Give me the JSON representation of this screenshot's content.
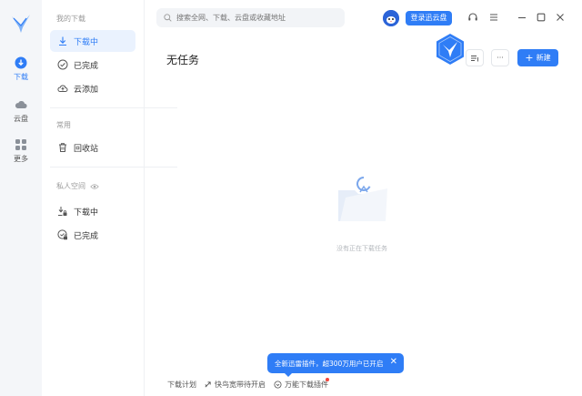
{
  "rail": {
    "items": [
      {
        "label": "下载",
        "icon": "download-circle-icon"
      },
      {
        "label": "云盘",
        "icon": "cloud-icon"
      },
      {
        "label": "更多",
        "icon": "grid-icon"
      }
    ]
  },
  "sidebar": {
    "section_my_downloads": "我的下载",
    "items": [
      {
        "label": "下载中",
        "icon": "download-arrow-icon"
      },
      {
        "label": "已完成",
        "icon": "check-circle-icon"
      },
      {
        "label": "云添加",
        "icon": "cloud-upload-icon"
      }
    ],
    "section_common": "常用",
    "common_items": [
      {
        "label": "回收站",
        "icon": "trash-icon"
      }
    ],
    "section_private": "私人空间",
    "private_items": [
      {
        "label": "下载中",
        "icon": "lock-download-icon"
      },
      {
        "label": "已完成",
        "icon": "lock-check-icon"
      }
    ]
  },
  "topbar": {
    "search_placeholder": "搜索全网、下载、云盘或收藏地址",
    "login_label": "登录迅云盘"
  },
  "main": {
    "title": "无任务",
    "new_label": "新建",
    "more_label": "···",
    "empty_text": "没有正在下载任务"
  },
  "tip": {
    "text": "全新迅雷插件，超300万用户已开启",
    "close": "✕"
  },
  "footer": {
    "plan": "下载计划",
    "speed": "快鸟宽带待开启",
    "plugin": "万能下载插件"
  },
  "colors": {
    "accent": "#2f7df6",
    "rail_bg": "#f4f6f9",
    "active_bg": "#eaf2fe"
  }
}
